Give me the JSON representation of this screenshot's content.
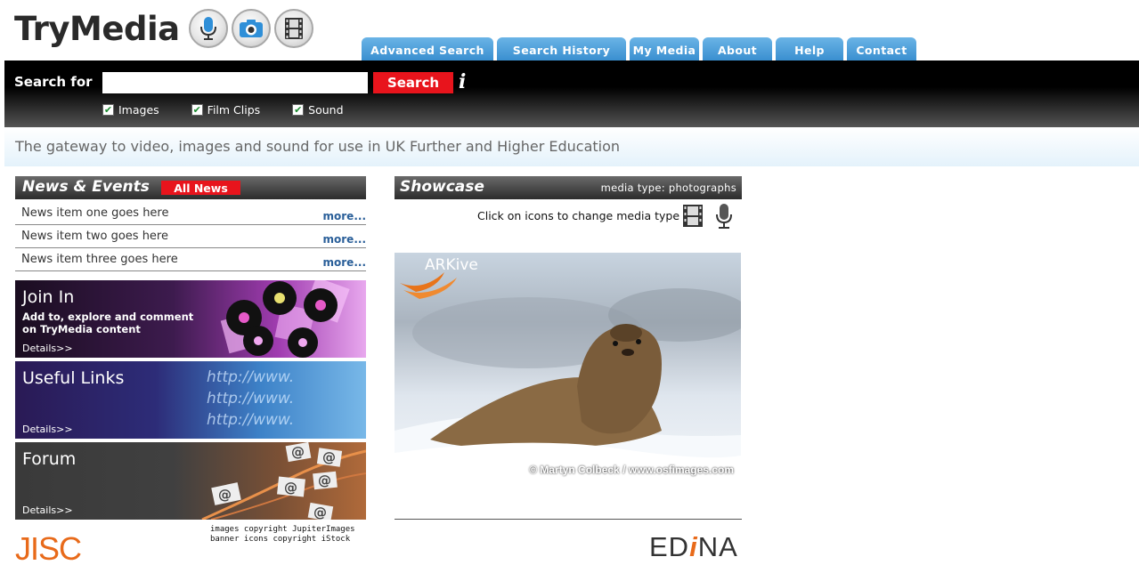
{
  "logo": {
    "text": "TryMedia",
    "icons": [
      "microphone-icon",
      "camera-icon",
      "film-icon"
    ]
  },
  "nav": {
    "tabs": [
      {
        "label": "Advanced Search"
      },
      {
        "label": "Search History"
      },
      {
        "label": "My Media"
      },
      {
        "label": "About"
      },
      {
        "label": "Help"
      },
      {
        "label": "Contact"
      }
    ],
    "tab_color": "#3a8fd0"
  },
  "search": {
    "label": "Search for",
    "value": "",
    "button": "Search",
    "info": "i",
    "filters": [
      {
        "label": "Images",
        "checked": true
      },
      {
        "label": "Film Clips",
        "checked": true
      },
      {
        "label": "Sound",
        "checked": true
      }
    ]
  },
  "tagline": "The gateway to video, images and sound for use in UK Further and Higher Education",
  "news": {
    "title": "News & Events",
    "all_news": "All News",
    "items": [
      {
        "text": "News item one goes here",
        "more": "more..."
      },
      {
        "text": "News item two goes here",
        "more": "more..."
      },
      {
        "text": "News item three goes here",
        "more": "more..."
      }
    ]
  },
  "promos": {
    "join": {
      "title": "Join In",
      "desc": "Add to, explore and comment on TryMedia content",
      "details": "Details>>"
    },
    "links": {
      "title": "Useful Links",
      "details": "Details>>",
      "urls": [
        "http://www.",
        "http://www.",
        "http://www."
      ]
    },
    "forum": {
      "title": "Forum",
      "details": "Details>>"
    }
  },
  "copyright": {
    "line1": "images copyright JupiterImages",
    "line2": "banner icons copyright iStock"
  },
  "jisc": "JISC",
  "showcase": {
    "title": "Showcase",
    "media_type": "media type: photographs",
    "hint": "Click on icons to change media type",
    "photo_watermark": "ARKive",
    "photo_credit": "© Martyn Colbeck / www.osfimages.com"
  },
  "edina": {
    "pre": "ED",
    "i": "i",
    "post": "NA"
  },
  "colors": {
    "accent_red": "#e8141c",
    "brand_orange": "#e86a1a",
    "link_blue": "#2a5f99"
  }
}
